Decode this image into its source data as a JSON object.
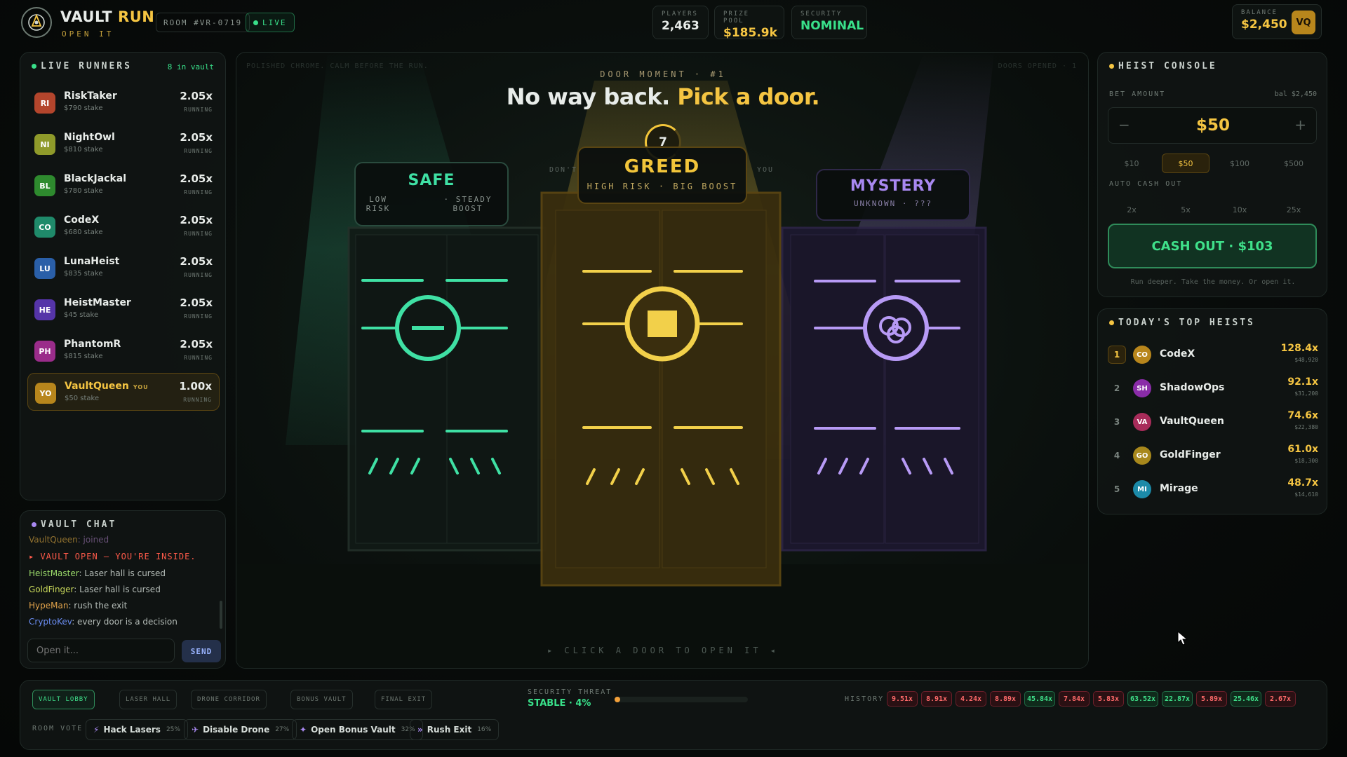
{
  "header": {
    "brand_main": "VAULT",
    "brand_accent": "RUN",
    "tagline": "OPEN IT",
    "room": "ROOM #VR-0719",
    "live": "LIVE",
    "stats": [
      {
        "label": "PLAYERS",
        "value": "2,463"
      },
      {
        "label": "PRIZE POOL",
        "value": "$185.9k"
      },
      {
        "label": "SECURITY",
        "value": "NOMINAL"
      }
    ],
    "balance_label": "BALANCE",
    "balance_value": "$2,450",
    "avatar": "VQ"
  },
  "runners": {
    "title": "LIVE RUNNERS",
    "count": "8 in vault",
    "items": [
      {
        "initials": "RI",
        "name": "RiskTaker",
        "stake": "$790 stake",
        "mult": "2.05x",
        "status": "RUNNING",
        "color": "#b3452c"
      },
      {
        "initials": "NI",
        "name": "NightOwl",
        "stake": "$810 stake",
        "mult": "2.05x",
        "status": "RUNNING",
        "color": "#8f9a2a"
      },
      {
        "initials": "BL",
        "name": "BlackJackal",
        "stake": "$780 stake",
        "mult": "2.05x",
        "status": "RUNNING",
        "color": "#2e8a2e"
      },
      {
        "initials": "CO",
        "name": "CodeX",
        "stake": "$680 stake",
        "mult": "2.05x",
        "status": "RUNNING",
        "color": "#1f8a6a"
      },
      {
        "initials": "LU",
        "name": "LunaHeist",
        "stake": "$835 stake",
        "mult": "2.05x",
        "status": "RUNNING",
        "color": "#2a5fa8"
      },
      {
        "initials": "HE",
        "name": "HeistMaster",
        "stake": "$45 stake",
        "mult": "2.05x",
        "status": "RUNNING",
        "color": "#5534a8"
      },
      {
        "initials": "PH",
        "name": "PhantomR",
        "stake": "$815 stake",
        "mult": "2.05x",
        "status": "RUNNING",
        "color": "#9a2c8a"
      },
      {
        "initials": "YO",
        "name": "VaultQueen",
        "you": "YOU",
        "stake": "$50 stake",
        "mult": "1.00x",
        "status": "RUNNING",
        "color": "#b8861c"
      }
    ]
  },
  "chat": {
    "title": "VAULT CHAT",
    "partial": {
      "user": "VaultQueen",
      "msg": ": joined"
    },
    "system": "▸ VAULT OPEN — YOU'RE INSIDE.",
    "messages": [
      {
        "user": "HeistMaster",
        "msg": ": Laser hall is cursed",
        "color": "#9ad96a"
      },
      {
        "user": "GoldFinger",
        "msg": ": Laser hall is cursed",
        "color": "#c8d85a"
      },
      {
        "user": "HypeMan",
        "msg": ": rush the exit",
        "color": "#e0a24a"
      },
      {
        "user": "CryptoKev",
        "msg": ": every door is a decision",
        "color": "#6a8cf0"
      }
    ],
    "placeholder": "Open it...",
    "send": "SEND"
  },
  "stage": {
    "top_left_1": "DOOR MOMENT · #1",
    "faint_left": "POLISHED CHROME. CALM BEFORE THE RUN.",
    "faint_right": "DOORS OPENED · 1",
    "headline_white": "No way back.",
    "headline_gold": "Pick a door.",
    "timer": "7",
    "side_left": "DON'T",
    "side_right": "YOU",
    "footer": "▸ CLICK A DOOR TO OPEN IT ◂",
    "doors": [
      {
        "title": "SAFE",
        "sub1": "LOW RISK",
        "sub2": "· STEADY BOOST",
        "color": "#3fe0a4"
      },
      {
        "title": "GREED",
        "sub1": "HIGH RISK",
        "sub2": "· BIG BOOST",
        "color": "#f2c53a"
      },
      {
        "title": "MYSTERY",
        "sub1": "UNKNOWN",
        "sub2": "· ???",
        "color": "#a888f0"
      }
    ]
  },
  "console": {
    "title": "HEIST CONSOLE",
    "bet_label": "BET AMOUNT",
    "bet_bal": "bal $2,450",
    "bet_value": "$50",
    "minus": "−",
    "plus": "+",
    "chips": [
      "$10",
      "$50",
      "$100",
      "$500"
    ],
    "auto_label": "AUTO CASH OUT",
    "auto": [
      "2x",
      "5x",
      "10x",
      "25x"
    ],
    "cashout": "CASH OUT · $103",
    "hint": "Run deeper. Take the money. Or open it."
  },
  "top_heists": {
    "title": "TODAY'S TOP HEISTS",
    "items": [
      {
        "rank": "1",
        "initials": "CO",
        "name": "CodeX",
        "mult": "128.4x",
        "amount": "$48,920",
        "color": "#b8861c"
      },
      {
        "rank": "2",
        "initials": "SH",
        "name": "ShadowOps",
        "mult": "92.1x",
        "amount": "$31,200",
        "color": "#8a2ca8"
      },
      {
        "rank": "3",
        "initials": "VA",
        "name": "VaultQueen",
        "mult": "74.6x",
        "amount": "$22,380",
        "color": "#a82c5a"
      },
      {
        "rank": "4",
        "initials": "GO",
        "name": "GoldFinger",
        "mult": "61.0x",
        "amount": "$18,300",
        "color": "#a8881c"
      },
      {
        "rank": "5",
        "initials": "MI",
        "name": "Mirage",
        "mult": "48.7x",
        "amount": "$14,610",
        "color": "#1c8aa8"
      }
    ]
  },
  "footer": {
    "stages": [
      "VAULT LOBBY",
      "LASER HALL",
      "DRONE CORRIDOR",
      "BONUS VAULT",
      "FINAL EXIT"
    ],
    "threat_label": "SECURITY THREAT",
    "threat_value": "STABLE · 4%",
    "threat_level": 0.04,
    "history_label": "HISTORY",
    "history": [
      {
        "v": "9.51x",
        "good": false
      },
      {
        "v": "8.91x",
        "good": false
      },
      {
        "v": "4.24x",
        "good": false
      },
      {
        "v": "8.89x",
        "good": false
      },
      {
        "v": "45.84x",
        "good": true
      },
      {
        "v": "7.84x",
        "good": false
      },
      {
        "v": "5.83x",
        "good": false
      },
      {
        "v": "63.52x",
        "good": true
      },
      {
        "v": "22.87x",
        "good": true
      },
      {
        "v": "5.89x",
        "good": false
      },
      {
        "v": "25.46x",
        "good": true
      },
      {
        "v": "2.67x",
        "good": false
      }
    ],
    "vote_label": "ROOM VOTE",
    "votes": [
      {
        "label": "Hack Lasers",
        "pct": "25%",
        "icon": "⚡"
      },
      {
        "label": "Disable Drone",
        "pct": "27%",
        "icon": "✈"
      },
      {
        "label": "Open Bonus Vault",
        "pct": "32%",
        "icon": "✦"
      },
      {
        "label": "Rush Exit",
        "pct": "16%",
        "icon": "»"
      }
    ]
  }
}
